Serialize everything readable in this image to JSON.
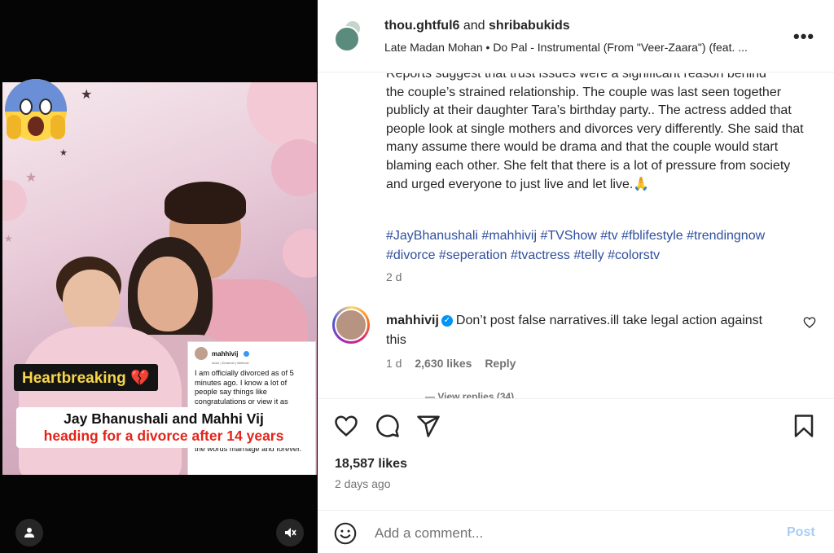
{
  "post": {
    "owner_primary": "thou.ghtful6",
    "owners_joiner": "and",
    "owner_secondary": "shribabukids",
    "audio": "Late Madan Mohan • Do Pal - Instrumental (From \"Veer-Zaara\") (feat. ...",
    "more_icon": "more-horizontal-icon"
  },
  "media": {
    "tag_label": "Heartbreaking 💔",
    "headline_line1": "Jay Bhanushali and Mahhi Vij",
    "headline_line2": "heading for a divorce after 14 years",
    "tweet": {
      "username": "mahhivij",
      "bio": "Actor | Dreamer | Believer",
      "text": "I am officially divorced as of 5 minutes ago. I know a lot of people say things like congratulations or view it as something to be celebrated, but to me, no matter the scenario, divorce will always be a sad thing. It takes away meaning to the words marriage and forever."
    },
    "emoji": "shocked-face-emoji",
    "user_tag_icon": "user-icon",
    "mute_icon": "muted-speaker-icon"
  },
  "caption": {
    "text_cut_line": "Reports suggest that trust issues were a significant reason behind",
    "text": "the couple’s strained relationship. The couple was last seen together publicly at their daughter Tara’s birthday party.. The actress added that people look at single mothers and divorces very differently. She said that many assume there would be drama and that the couple would start blaming each other. She felt that there is a lot of pressure from society and urged everyone to just live and let live.🙏",
    "hashtags": "#JayBhanushali #mahhivij #TVShow #tv #fblifestyle #trendingnow #divorce #seperation #tvactress #telly #colorstv",
    "time": "2 d"
  },
  "comment": {
    "username": "mahhivij",
    "verified": "✓",
    "text": "Don’t post false narratives.ill take legal action against this",
    "time": "1 d",
    "likes": "2,630 likes",
    "reply": "Reply",
    "view_replies": "— View replies (34)"
  },
  "actions": {
    "like_icon": "heart-icon",
    "comment_icon": "comment-icon",
    "share_icon": "send-icon",
    "save_icon": "bookmark-icon"
  },
  "stats": {
    "likes": "18,587 likes",
    "posted": "2 days ago"
  },
  "add_comment": {
    "placeholder": "Add a comment...",
    "post_label": "Post",
    "emoji_icon": "smiley-icon"
  },
  "colors": {
    "link": "#2f4f9f",
    "post_disabled": "#a8cdf5",
    "verified": "#0095f6"
  }
}
